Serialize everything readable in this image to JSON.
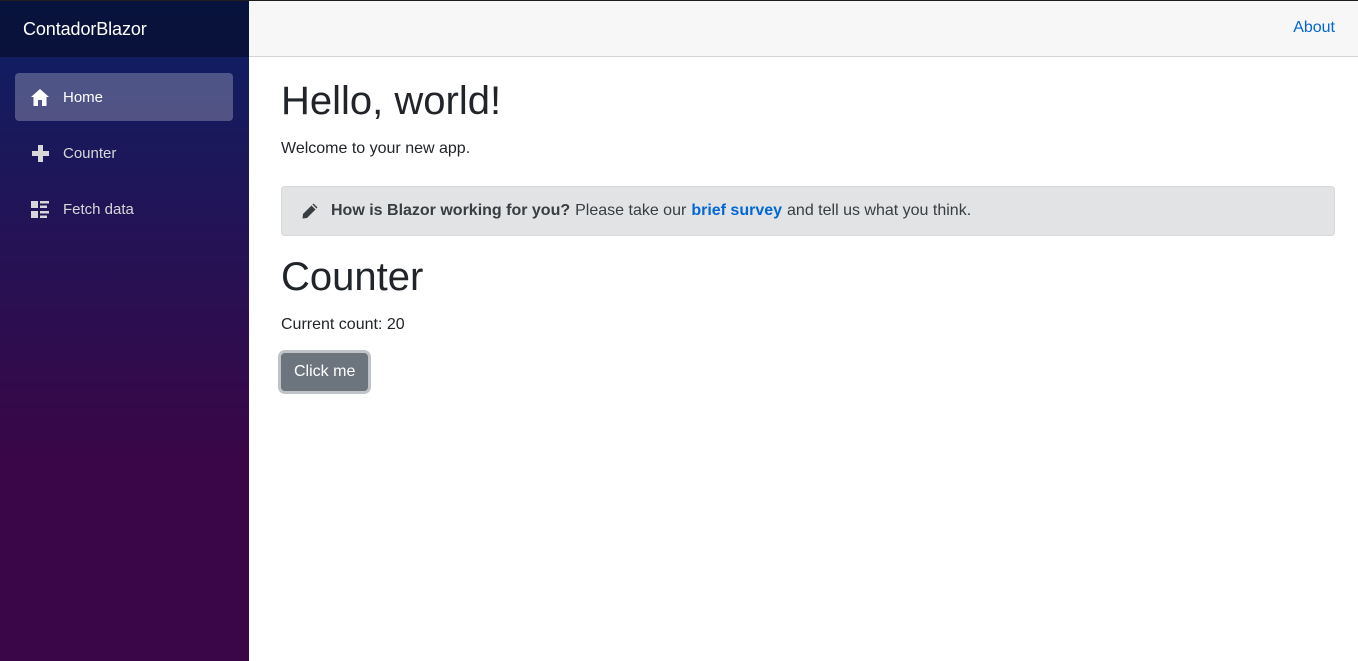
{
  "sidebar": {
    "brand": "ContadorBlazor",
    "items": [
      {
        "label": "Home",
        "icon": "home-icon",
        "active": true
      },
      {
        "label": "Counter",
        "icon": "plus-icon",
        "active": false
      },
      {
        "label": "Fetch data",
        "icon": "list-rich-icon",
        "active": false
      }
    ]
  },
  "header": {
    "about_label": "About"
  },
  "main": {
    "title": "Hello, world!",
    "welcome": "Welcome to your new app.",
    "survey": {
      "icon": "pencil-icon",
      "bold": "How is Blazor working for you?",
      "before_link": "Please take our",
      "link": "brief survey",
      "after_link": "and tell us what you think."
    },
    "counter": {
      "title": "Counter",
      "count_text": "Current count: 20",
      "button_label": "Click me"
    }
  },
  "colors": {
    "link": "#0366d6",
    "button": "#6c757d",
    "sidebar_top": "#0c2064",
    "sidebar_bottom": "#3a0647"
  }
}
